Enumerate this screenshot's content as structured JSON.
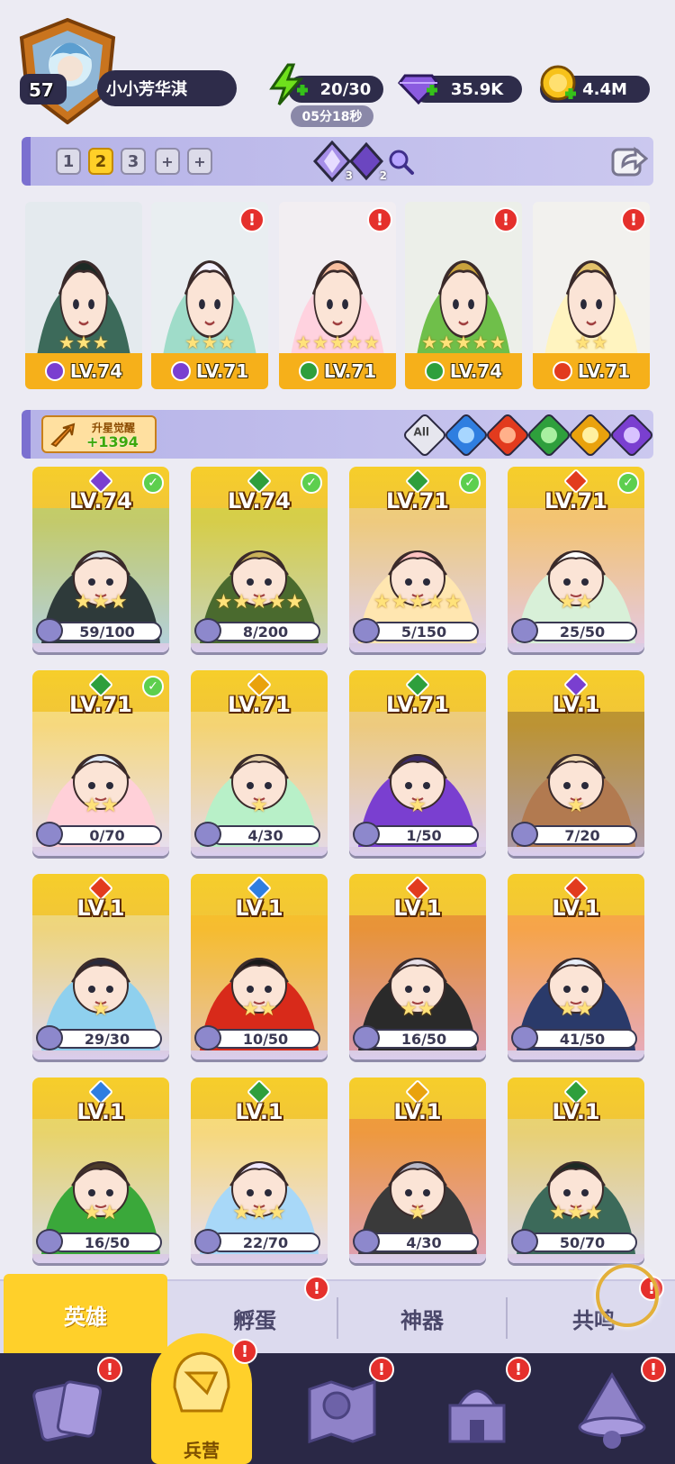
{
  "player": {
    "level": "57",
    "name": "小小芳华淇"
  },
  "resources": {
    "energy": "20/30",
    "energy_timer": "05分18秒",
    "gems": "35.9K",
    "gold": "4.4M"
  },
  "teams": {
    "tabs": [
      "1",
      "2",
      "3",
      "+",
      "+"
    ],
    "active_tab": "2",
    "crystal_purple_count": "3",
    "crystal_dark_count": "2"
  },
  "featured_heroes": [
    {
      "level": "LV.74",
      "element": "dark",
      "stars": 3,
      "alert": false
    },
    {
      "level": "LV.71",
      "element": "dark",
      "stars": 3,
      "alert": true
    },
    {
      "level": "LV.71",
      "element": "wind",
      "stars": 5,
      "alert": true
    },
    {
      "level": "LV.74",
      "element": "wind",
      "stars": 5,
      "alert": true
    },
    {
      "level": "LV.71",
      "element": "fire",
      "stars": 2,
      "alert": true
    }
  ],
  "awaken": {
    "label": "升星觉醒",
    "value": "+1394"
  },
  "filters": {
    "all_label": "All"
  },
  "colors": {
    "dark": "#7a3fd0",
    "wind": "#2e9f3c",
    "fire": "#e23b1e",
    "water": "#2f7ee0",
    "light": "#e9a20d",
    "accent": "#ffd02a",
    "alert": "#e5302c"
  },
  "heroes": [
    {
      "level": "LV.74",
      "element": "dark",
      "stars": 3,
      "progress": "59/100",
      "check": true
    },
    {
      "level": "LV.74",
      "element": "wind",
      "stars": 5,
      "progress": "8/200",
      "check": true
    },
    {
      "level": "LV.71",
      "element": "wind",
      "stars": 5,
      "progress": "5/150",
      "check": true
    },
    {
      "level": "LV.71",
      "element": "fire",
      "stars": 2,
      "progress": "25/50",
      "check": true
    },
    {
      "level": "LV.71",
      "element": "wind",
      "stars": 2,
      "progress": "0/70",
      "check": true
    },
    {
      "level": "LV.71",
      "element": "light",
      "stars": 1,
      "progress": "4/30",
      "check": false
    },
    {
      "level": "LV.71",
      "element": "wind",
      "stars": 1,
      "progress": "1/50",
      "check": false
    },
    {
      "level": "LV.1",
      "element": "dark",
      "stars": 1,
      "progress": "7/20",
      "check": false
    },
    {
      "level": "LV.1",
      "element": "fire",
      "stars": 1,
      "progress": "29/30",
      "check": false
    },
    {
      "level": "LV.1",
      "element": "water",
      "stars": 2,
      "progress": "10/50",
      "check": false
    },
    {
      "level": "LV.1",
      "element": "fire",
      "stars": 2,
      "progress": "16/50",
      "check": false
    },
    {
      "level": "LV.1",
      "element": "fire",
      "stars": 2,
      "progress": "41/50",
      "check": false
    },
    {
      "level": "LV.1",
      "element": "water",
      "stars": 2,
      "progress": "16/50",
      "check": false
    },
    {
      "level": "LV.1",
      "element": "wind",
      "stars": 3,
      "progress": "22/70",
      "check": false
    },
    {
      "level": "LV.1",
      "element": "light",
      "stars": 1,
      "progress": "4/30",
      "check": false
    },
    {
      "level": "LV.1",
      "element": "wind",
      "stars": 3,
      "progress": "50/70",
      "check": false
    }
  ],
  "sub_tabs": [
    {
      "label": "英雄",
      "active": true,
      "alert": false
    },
    {
      "label": "孵蛋",
      "active": false,
      "alert": true
    },
    {
      "label": "神器",
      "active": false,
      "alert": false
    },
    {
      "label": "共鸣",
      "active": false,
      "alert": true
    }
  ],
  "bottom_nav": [
    {
      "icon": "cards-icon",
      "label": "",
      "alert": true
    },
    {
      "icon": "barracks-icon",
      "label": "兵营",
      "alert": true,
      "active": true
    },
    {
      "icon": "map-icon",
      "label": "",
      "alert": true
    },
    {
      "icon": "castle-icon",
      "label": "",
      "alert": true
    },
    {
      "icon": "wizard-icon",
      "label": "",
      "alert": true
    }
  ]
}
